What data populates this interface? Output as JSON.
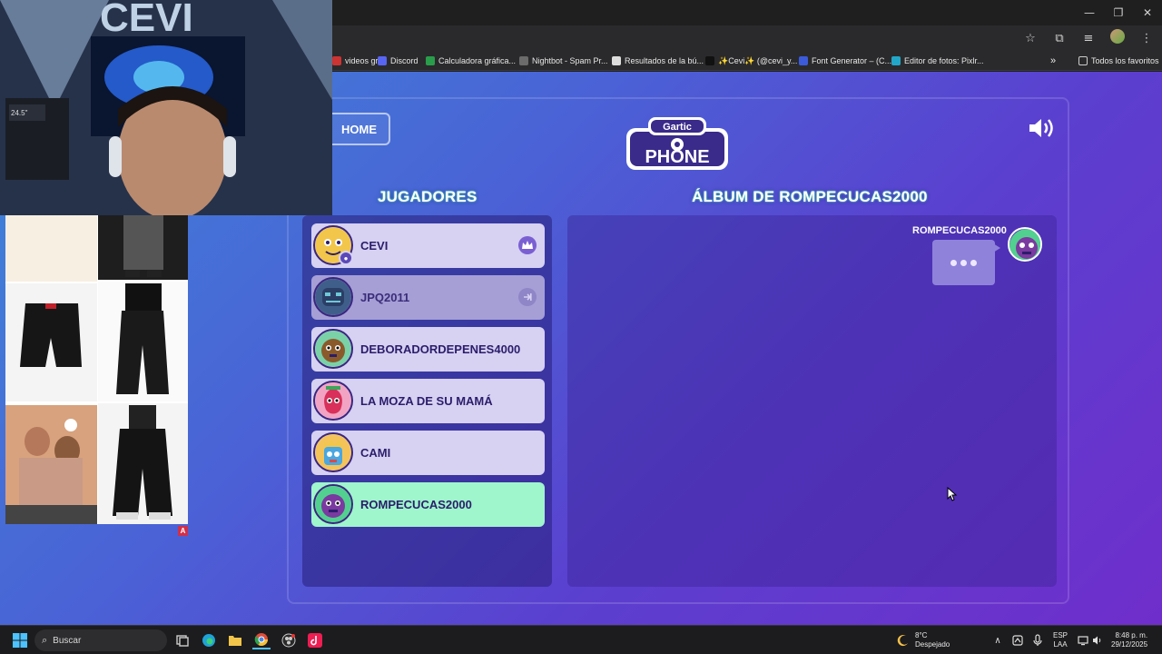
{
  "browser": {
    "bookmarks": [
      {
        "label": "videos gr...",
        "color": "#cc3333"
      },
      {
        "label": "Discord",
        "color": "#5865f2"
      },
      {
        "label": "Calculadora gráfica...",
        "color": "#2a9d4b"
      },
      {
        "label": "Nightbot - Spam Pr...",
        "color": "#6b6b6b"
      },
      {
        "label": "Resultados de la bú...",
        "color": "#dddddd"
      },
      {
        "label": "✨Cevi✨ (@cevi_y...",
        "color": "#111111"
      },
      {
        "label": "Font Generator – (C...",
        "color": "#3b5bdb"
      },
      {
        "label": "Editor de fotos: Pixlr...",
        "color": "#22a6c8"
      }
    ],
    "all_bookmarks_label": "Todos los favoritos"
  },
  "game": {
    "home_label": "HOME",
    "logo_top": "Gartic",
    "logo_bottom": "PHONE",
    "players_heading": "JUGADORES",
    "album_heading": "ÁLBUM DE ROMPECUCAS2000",
    "players": [
      {
        "name": "CEVI",
        "state": "host"
      },
      {
        "name": "JPQ2011",
        "state": "away"
      },
      {
        "name": "DEBORADORDEPENES4000",
        "state": "normal"
      },
      {
        "name": "LA MOZA DE SU MAMÁ",
        "state": "normal"
      },
      {
        "name": "CAMI",
        "state": "normal"
      },
      {
        "name": "ROMPECUCAS2000",
        "state": "active"
      }
    ],
    "album_user": "ROMPECUCAS2000"
  },
  "stream_label": "A",
  "taskbar": {
    "search_placeholder": "Buscar",
    "weather_temp": "8°C",
    "weather_desc": "Despejado",
    "lang_top": "ESP",
    "lang_bottom": "LAA",
    "time": "8:48 p. m.",
    "date": "29/12/2025"
  }
}
